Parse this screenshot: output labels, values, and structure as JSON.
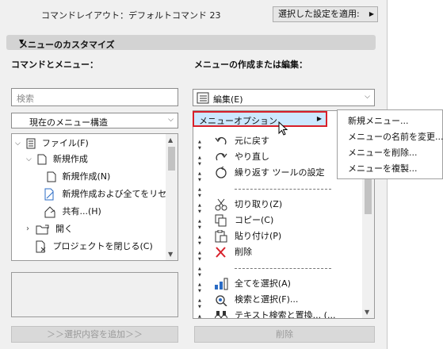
{
  "header": {
    "scheme_label": "コマンドレイアウト：デフォルトコマンド 23",
    "apply_button": "選択した設定を適用:"
  },
  "section": {
    "title": "メニューのカスタマイズ"
  },
  "left": {
    "title": "コマンドとメニュー：",
    "search_placeholder": "検索",
    "structure_select": "現在のメニュー構造",
    "tree": [
      "ファイル(F)",
      "新規作成",
      "新規作成(N)",
      "新規作成および全てをリセッ",
      "共有...(H)",
      "開く",
      "プロジェクトを閉じる(C)"
    ],
    "add_button": "＞＞選択内容を追加＞＞"
  },
  "right": {
    "title": "メニューの作成または編集：",
    "menu_select": "編集(E)",
    "menu_options_item": "メニューオプション",
    "items": [
      "元に戻す",
      "やり直し",
      "繰り返す ツールの設定",
      "切り取り(Z)",
      "コピー(C)",
      "貼り付け(P)",
      "削除",
      "全てを選択(A)",
      "検索と選択(F)...",
      "テキスト検索と置換... (..."
    ],
    "delete_button": "削除"
  },
  "popup": {
    "items": [
      "新規メニュー...",
      "メニューの名前を変更...",
      "メニューを削除...",
      "メニューを複製..."
    ]
  }
}
